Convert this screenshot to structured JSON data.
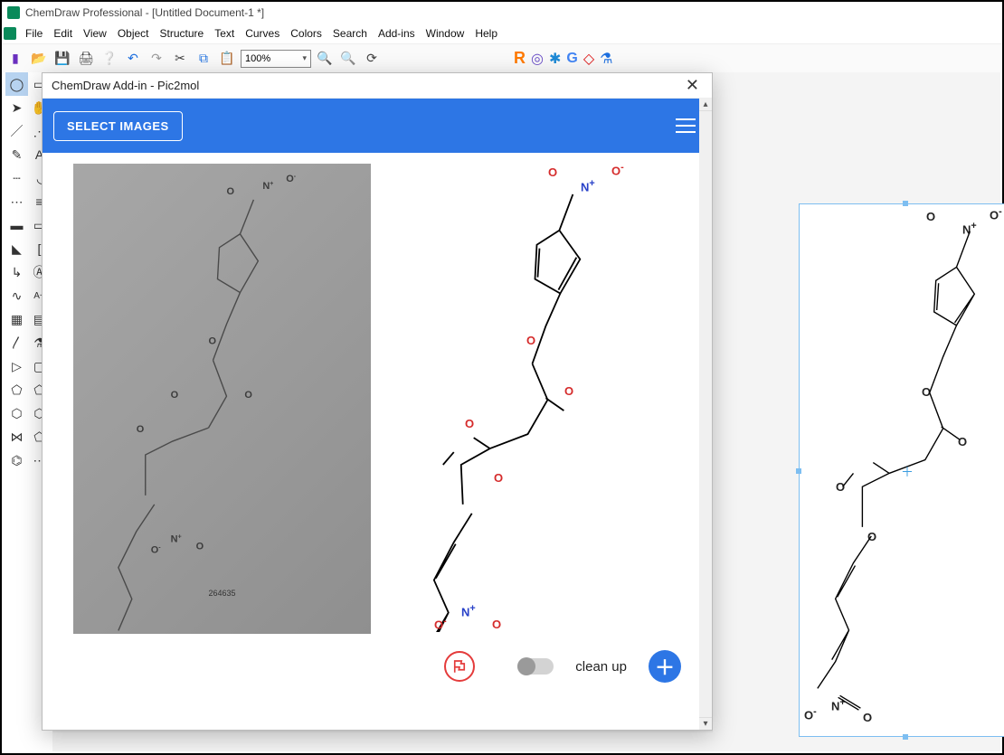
{
  "app": {
    "title": "ChemDraw Professional - [Untitled Document-1 *]"
  },
  "menu": [
    "File",
    "Edit",
    "View",
    "Object",
    "Structure",
    "Text",
    "Curves",
    "Colors",
    "Search",
    "Add-ins",
    "Window",
    "Help"
  ],
  "toolbar": {
    "zoom": "100%"
  },
  "dialog": {
    "title": "ChemDraw Add-in - Pic2mol",
    "select_images": "SELECT IMAGES",
    "cleanup": "clean up",
    "photo_caption": "264635"
  },
  "palette_tools": [
    "lasso-tool",
    "marquee-tool",
    "arrow-tool",
    "bold-arrow-tool",
    "line-tool",
    "dashed-line-tool",
    "dotted-line-tool",
    "wavy-line-tool",
    "eraser-tool",
    "text-tool",
    "arc-tool",
    "squiggle-tool",
    "table-tool",
    "scissors-tool",
    "bracket-tool",
    "brace-tool",
    "triangle-tool",
    "rect-tool",
    "pentagon-tool",
    "hexagon-tool",
    "benzene-tool",
    "cyclo-tool",
    "ring-tool",
    "chain-tool"
  ],
  "addin_icons": [
    "R",
    "cube",
    "hex",
    "G",
    "hazard",
    "flask"
  ],
  "molecule": {
    "atoms_top": [
      "O",
      "N+",
      "O-"
    ],
    "atoms_mid": [
      "O",
      "O",
      "O",
      "O"
    ],
    "atoms_bot": [
      "O-",
      "N+",
      "O"
    ]
  }
}
